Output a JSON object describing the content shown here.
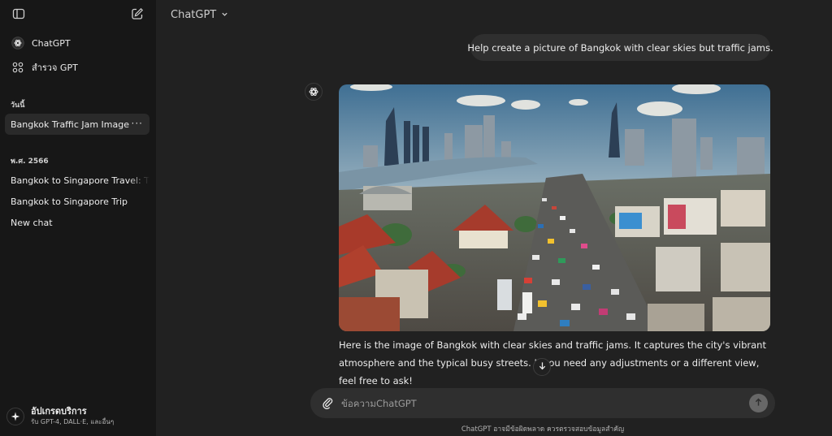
{
  "sidebar": {
    "toggle_icon": "sidebar-toggle-icon",
    "new_chat_icon": "compose-icon",
    "nav": [
      {
        "label": "ChatGPT",
        "icon": "chatgpt-logo-icon"
      },
      {
        "label": "สำรวจ GPT",
        "icon": "grid-icon"
      }
    ],
    "sections": [
      {
        "title": "วันนี้",
        "items": [
          "Bangkok Traffic Jam Image"
        ]
      },
      {
        "title": "พ.ศ. 2566",
        "items": [
          "Bangkok to Singapore Travel: Tips",
          "Bangkok to Singapore Trip",
          "New chat"
        ]
      }
    ],
    "active_item_more": "···",
    "upgrade": {
      "title": "อัปเกรดบริการ",
      "subtitle": "รับ GPT-4, DALL·E, และอื่นๆ",
      "icon": "sparkle-icon"
    }
  },
  "header": {
    "model_name": "ChatGPT",
    "dropdown_icon": "chevron-down-icon"
  },
  "conversation": {
    "user_message": "Help create a picture of Bangkok with clear skies but traffic jams.",
    "assistant": {
      "avatar_icon": "chatgpt-logo-icon",
      "image_subject": "Bangkok cityscape with clear skies and traffic jams",
      "reply_text": "Here is the image of Bangkok with clear skies and traffic jams. It captures the city's vibrant atmosphere and the typical busy streets. If you need any adjustments or a different view, feel free to ask!"
    }
  },
  "composer": {
    "placeholder": "ข้อความChatGPT",
    "attach_icon": "paperclip-icon",
    "send_icon": "arrow-up-icon"
  },
  "disclaimer": "ChatGPT อาจมีข้อผิดพลาด ควรตรวจสอบข้อมูลสำคัญ",
  "colors": {
    "main_bg": "#212121",
    "sidebar_bg": "#171717",
    "bubble_bg": "#2f2f2f",
    "text": "#ececec"
  }
}
